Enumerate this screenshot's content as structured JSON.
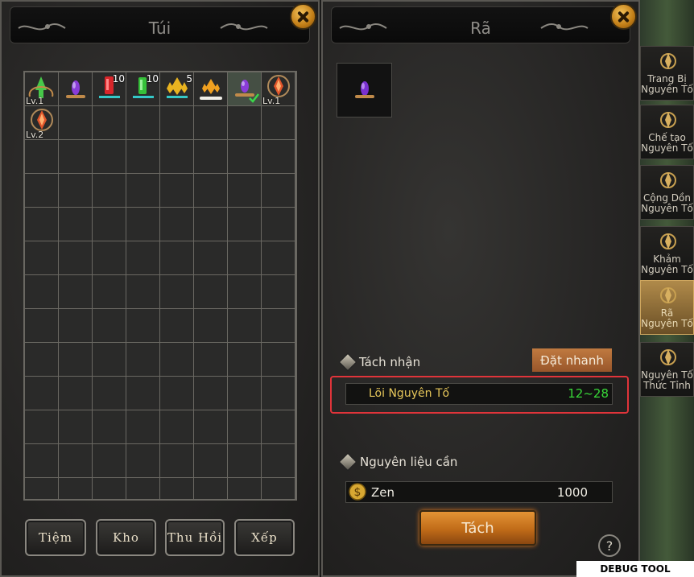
{
  "bag": {
    "title": "Túi",
    "slots": [
      {
        "icon": "green-crystal-icon",
        "level": "Lv.1",
        "quantity": "",
        "accent": "#47c84a"
      },
      {
        "icon": "purple-gem-icon",
        "level": "",
        "quantity": "",
        "accent": "#8a3cd8"
      },
      {
        "icon": "red-crystal-icon",
        "level": "",
        "quantity": "10",
        "accent": "#d8262a"
      },
      {
        "icon": "green-crystal-stack-icon",
        "level": "",
        "quantity": "10",
        "accent": "#36c03a"
      },
      {
        "icon": "gold-crystal-icon",
        "level": "",
        "quantity": "5",
        "accent": "#e8b320"
      },
      {
        "icon": "orange-crystal-icon",
        "level": "",
        "quantity": "",
        "accent": "#f0a020"
      },
      {
        "icon": "purple-gem-selected-icon",
        "level": "",
        "quantity": "",
        "accent": "#8a3cd8"
      },
      {
        "icon": "orange-rune-icon",
        "level": "Lv.1",
        "quantity": "",
        "accent": "#e0552a"
      },
      {
        "icon": "orange-rune-icon",
        "level": "Lv.2",
        "quantity": "",
        "accent": "#e0552a"
      }
    ],
    "buttons": {
      "shop": "Tiệm",
      "storage": "Kho",
      "recall": "Thu Hồi",
      "sort": "Xếp"
    }
  },
  "dismantle": {
    "title": "Rã",
    "receive_label": "Tách nhận",
    "quick_place_label": "Đặt nhanh",
    "result": {
      "name": "Lõi Nguyên Tố",
      "range": "12~28"
    },
    "materials_label": "Nguyên liệu cần",
    "cost": {
      "currency": "Zen",
      "amount": "1000"
    },
    "action_label": "Tách",
    "help_label": "?"
  },
  "sidebar": {
    "items": [
      {
        "label": "Trang Bị Nguyên Tố",
        "active": false
      },
      {
        "label": "Chế tạo Nguyên Tố",
        "active": false
      },
      {
        "label": "Cộng Dồn Nguyên Tố",
        "active": false
      },
      {
        "label": "Khảm Nguyên Tố",
        "active": false
      },
      {
        "label": "Rã Nguyên Tố",
        "active": true
      },
      {
        "label": "Nguyên Tố Thức Tỉnh",
        "active": false
      }
    ]
  },
  "debug_label": "DEBUG TOOL",
  "colors": {
    "accent": "#d47f2a",
    "highlight": "#e0343a",
    "range": "#38d838",
    "cost": "#f0ede4"
  }
}
